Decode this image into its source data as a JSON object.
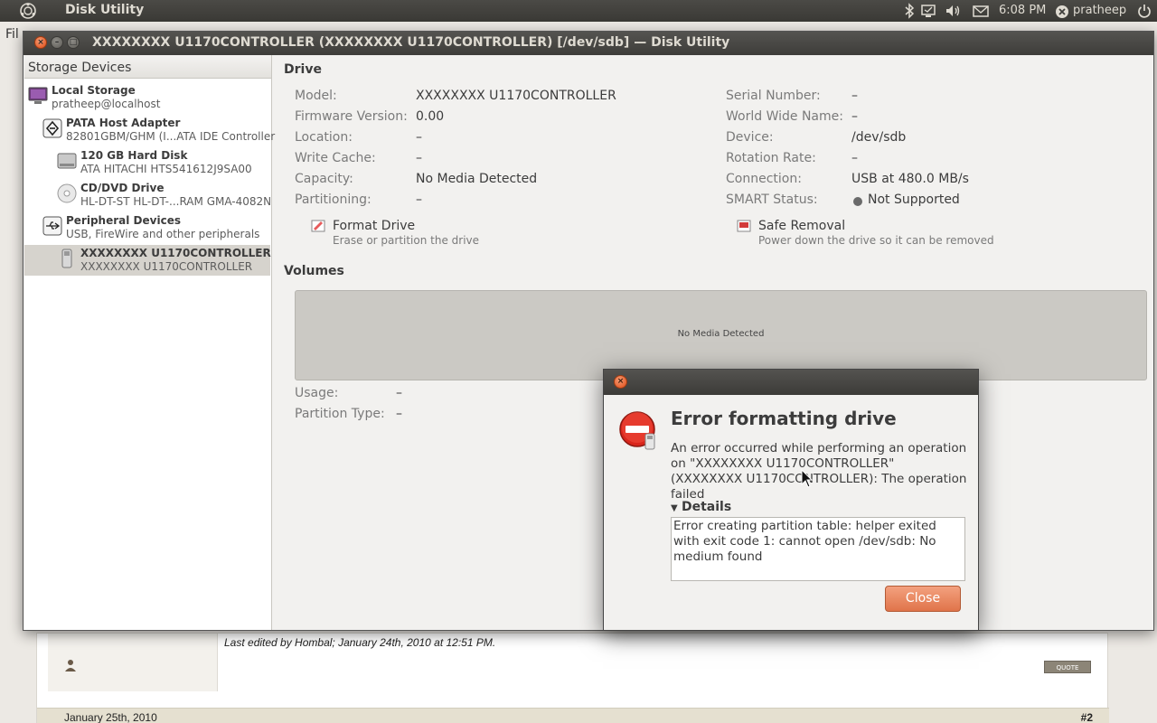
{
  "top_panel": {
    "app_name": "Disk Utility",
    "time": "6:08 PM",
    "user": "pratheep",
    "icons": [
      "ubuntu-logo-icon",
      "bluetooth-icon",
      "network-icon",
      "volume-icon",
      "mail-icon",
      "user-icon",
      "power-icon"
    ]
  },
  "background": {
    "menu_hint": "Fil",
    "edited_note": "Last edited by Hombal; January 24th, 2010 at 12:51 PM.",
    "quote_label": "QUOTE",
    "post_date": "January 25th, 2010",
    "post_number": "#2"
  },
  "window": {
    "title": "XXXXXXXX U1170CONTROLLER (XXXXXXXX U1170CONTROLLER) [/dev/sdb] — Disk Utility"
  },
  "sidebar": {
    "header": "Storage Devices",
    "items": [
      {
        "name": "Local Storage",
        "sub": "pratheep@localhost",
        "icon": "computer-icon"
      },
      {
        "name": "PATA Host Adapter",
        "sub": "82801GBM/GHM (I...ATA IDE Controller",
        "icon": "adapter-icon"
      },
      {
        "name": "120 GB Hard Disk",
        "sub": "ATA HITACHI HTS541612J9SA00",
        "icon": "hard-disk-icon"
      },
      {
        "name": "CD/DVD Drive",
        "sub": "HL-DT-ST HL-DT-...RAM GMA-4082N",
        "icon": "optical-drive-icon"
      },
      {
        "name": "Peripheral Devices",
        "sub": "USB, FireWire and other peripherals",
        "icon": "usb-icon"
      },
      {
        "name": "XXXXXXXX U1170CONTROLLER",
        "sub": "XXXXXXXX U1170CONTROLLER",
        "icon": "usb-drive-icon",
        "selected": true
      }
    ]
  },
  "drive": {
    "section_title": "Drive",
    "left": [
      {
        "label": "Model:",
        "value": "XXXXXXXX U1170CONTROLLER"
      },
      {
        "label": "Firmware Version:",
        "value": "0.00"
      },
      {
        "label": "Location:",
        "value": "–"
      },
      {
        "label": "Write Cache:",
        "value": "–"
      },
      {
        "label": "Capacity:",
        "value": "No Media Detected"
      },
      {
        "label": "Partitioning:",
        "value": "–"
      }
    ],
    "right": [
      {
        "label": "Serial Number:",
        "value": "–"
      },
      {
        "label": "World Wide Name:",
        "value": "–"
      },
      {
        "label": "Device:",
        "value": "/dev/sdb"
      },
      {
        "label": "Rotation Rate:",
        "value": "–"
      },
      {
        "label": "Connection:",
        "value": "USB at 480.0 MB/s"
      },
      {
        "label": "SMART Status:",
        "value": "Not Supported"
      }
    ],
    "actions": {
      "format": {
        "title": "Format Drive",
        "sub": "Erase or partition the drive"
      },
      "safe_removal": {
        "title": "Safe Removal",
        "sub": "Power down the drive so it can be removed"
      }
    }
  },
  "volumes": {
    "section_title": "Volumes",
    "bar_text": "No Media Detected",
    "usage_label": "Usage:",
    "usage_value": "–",
    "partition_type_label": "Partition Type:",
    "partition_type_value": "–"
  },
  "dialog": {
    "heading": "Error formatting drive",
    "message": "An error occurred while performing an operation on \"XXXXXXXX U1170CONTROLLER\" (XXXXXXXX U1170CONTROLLER): The operation failed",
    "details_label": "Details",
    "details_text": "Error creating partition table: helper exited with exit code 1: cannot open /dev/sdb: No medium found",
    "close_label": "Close"
  },
  "colors": {
    "accent": "#e0744a",
    "panel_dark": "#3e3d3a",
    "selection": "#d6d3cd"
  }
}
